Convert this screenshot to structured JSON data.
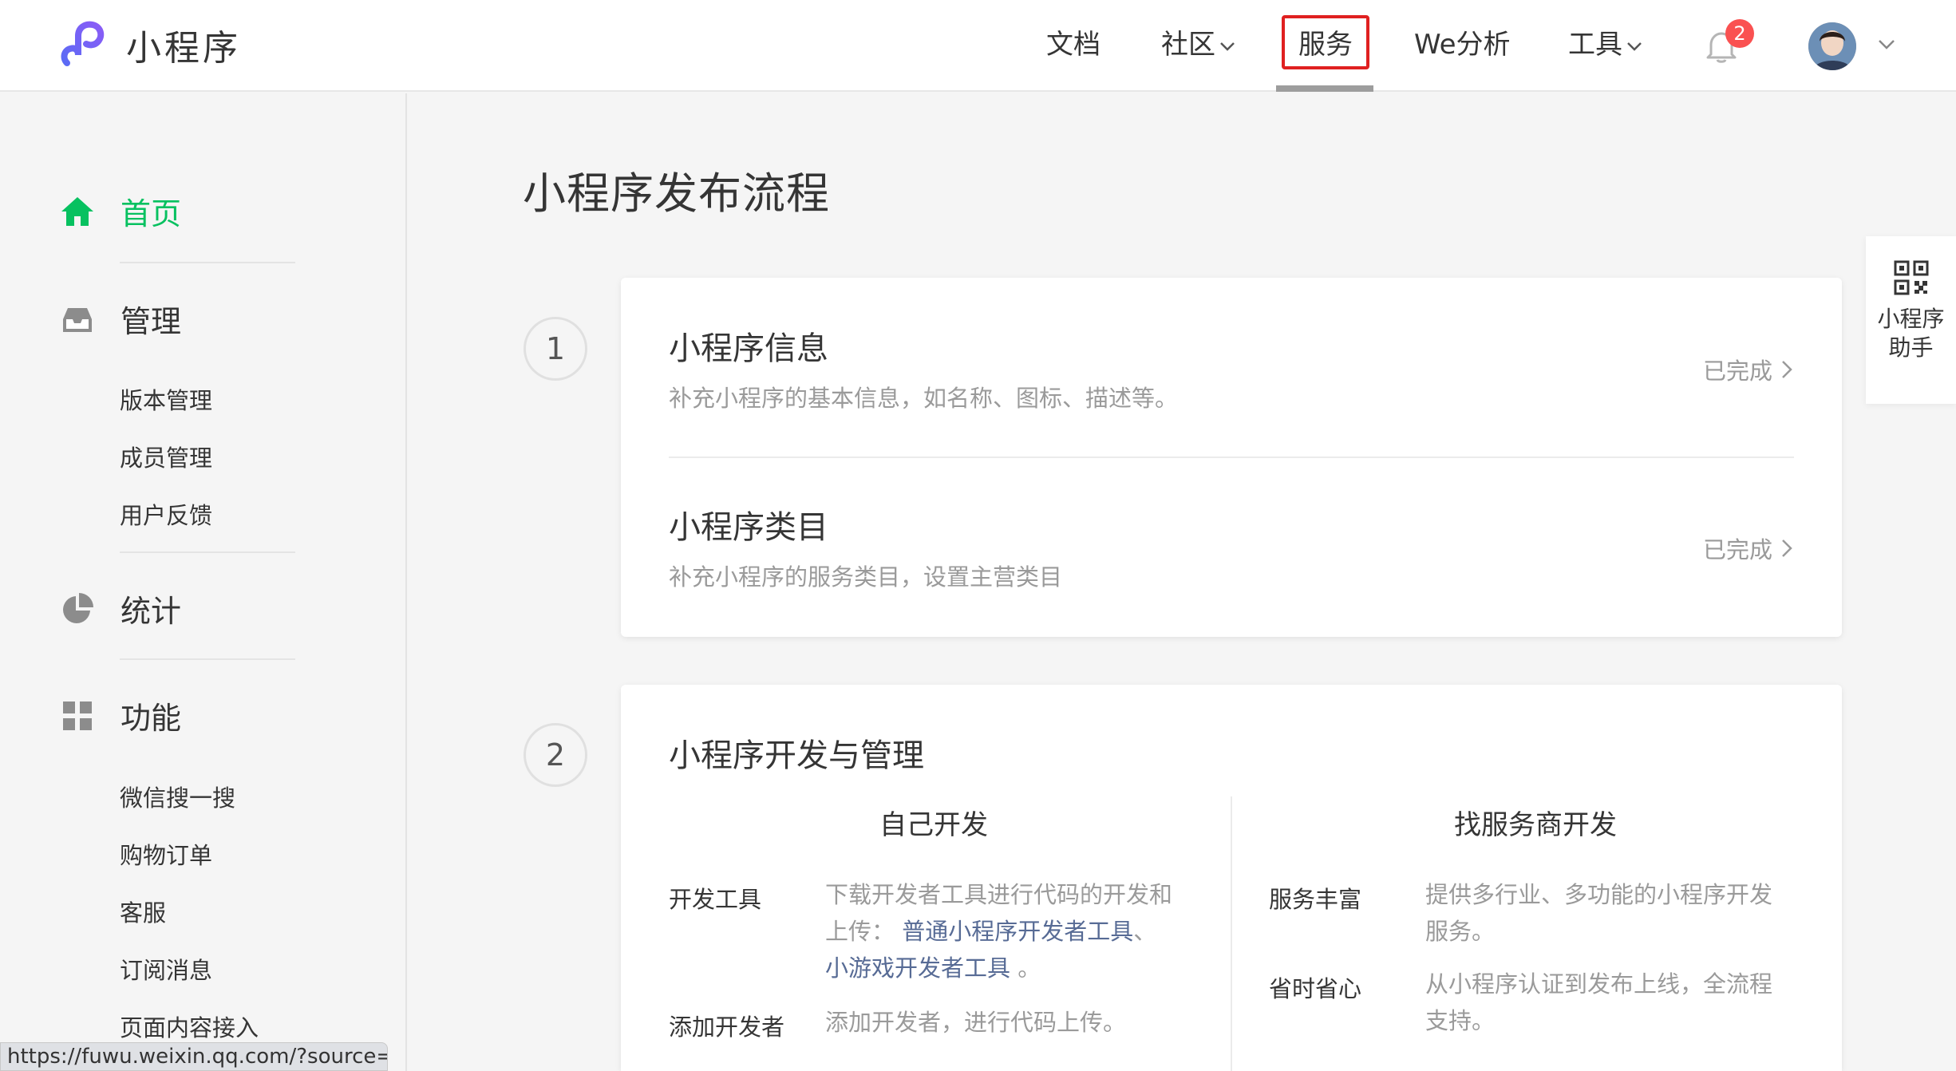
{
  "header": {
    "logo_text": "小程序",
    "nav": {
      "docs": "文档",
      "community": "社区",
      "services": "服务",
      "we_analysis": "We分析",
      "tools": "工具"
    },
    "notification_count": "2"
  },
  "sidebar": {
    "home": "首页",
    "manage": {
      "label": "管理",
      "items": [
        "版本管理",
        "成员管理",
        "用户反馈"
      ]
    },
    "stats": {
      "label": "统计"
    },
    "features": {
      "label": "功能",
      "items": [
        "微信搜一搜",
        "购物订单",
        "客服",
        "订阅消息",
        "页面内容接入"
      ]
    }
  },
  "main": {
    "title": "小程序发布流程",
    "step1": {
      "number": "1",
      "rows": [
        {
          "title": "小程序信息",
          "desc": "补充小程序的基本信息，如名称、图标、描述等。",
          "status": "已完成"
        },
        {
          "title": "小程序类目",
          "desc": "补充小程序的服务类目，设置主营类目",
          "status": "已完成"
        }
      ]
    },
    "step2": {
      "number": "2",
      "title": "小程序开发与管理",
      "left_col": {
        "heading": "自己开发",
        "items": [
          {
            "label": "开发工具",
            "desc_prefix": "下载开发者工具进行代码的开发和上传：",
            "link1": "普通小程序开发者工具",
            "sep": "、",
            "link2": "小游戏开发者工具",
            "suffix": "。"
          },
          {
            "label": "添加开发者",
            "desc": "添加开发者，进行代码上传。"
          }
        ]
      },
      "right_col": {
        "heading": "找服务商开发",
        "items": [
          {
            "label": "服务丰富",
            "desc": "提供多行业、多功能的小程序开发服务。"
          },
          {
            "label": "省时省心",
            "desc": "从小程序认证到发布上线，全流程支持。"
          }
        ]
      }
    }
  },
  "assistant": {
    "line1": "小程序",
    "line2": "助手"
  },
  "status_url": "https://fuwu.weixin.qq.com/?source=mp",
  "colors": {
    "brand_green": "#07c160",
    "link_blue": "#576b95",
    "highlight_red": "#e02020",
    "badge_red": "#fa5151"
  }
}
